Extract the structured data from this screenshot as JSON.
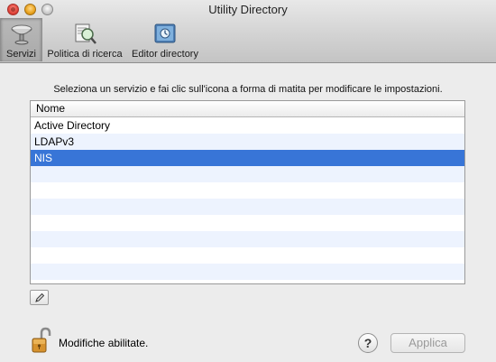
{
  "window": {
    "title": "Utility Directory"
  },
  "toolbar": {
    "items": [
      {
        "label": "Servizi",
        "icon": "services-icon",
        "selected": true
      },
      {
        "label": "Politica di ricerca",
        "icon": "search-policy-icon",
        "selected": false
      },
      {
        "label": "Editor directory",
        "icon": "directory-editor-icon",
        "selected": false
      }
    ]
  },
  "instruction": "Seleziona un servizio e fai clic sull'icona a forma di matita per modificare le impostazioni.",
  "table": {
    "column_header": "Nome",
    "rows": [
      "Active Directory",
      "LDAPv3",
      "NIS",
      "",
      "",
      "",
      "",
      "",
      "",
      ""
    ],
    "selected_row": "NIS"
  },
  "edit_button": {
    "icon": "pencil-icon"
  },
  "lock": {
    "label": "Modifiche abilitate.",
    "icon": "unlocked-padlock-icon"
  },
  "help_button": {
    "label": "?"
  },
  "apply_button": {
    "label": "Applica",
    "enabled": false
  },
  "colors": {
    "selection": "#3875d7",
    "alt_row": "#edf3fe"
  }
}
